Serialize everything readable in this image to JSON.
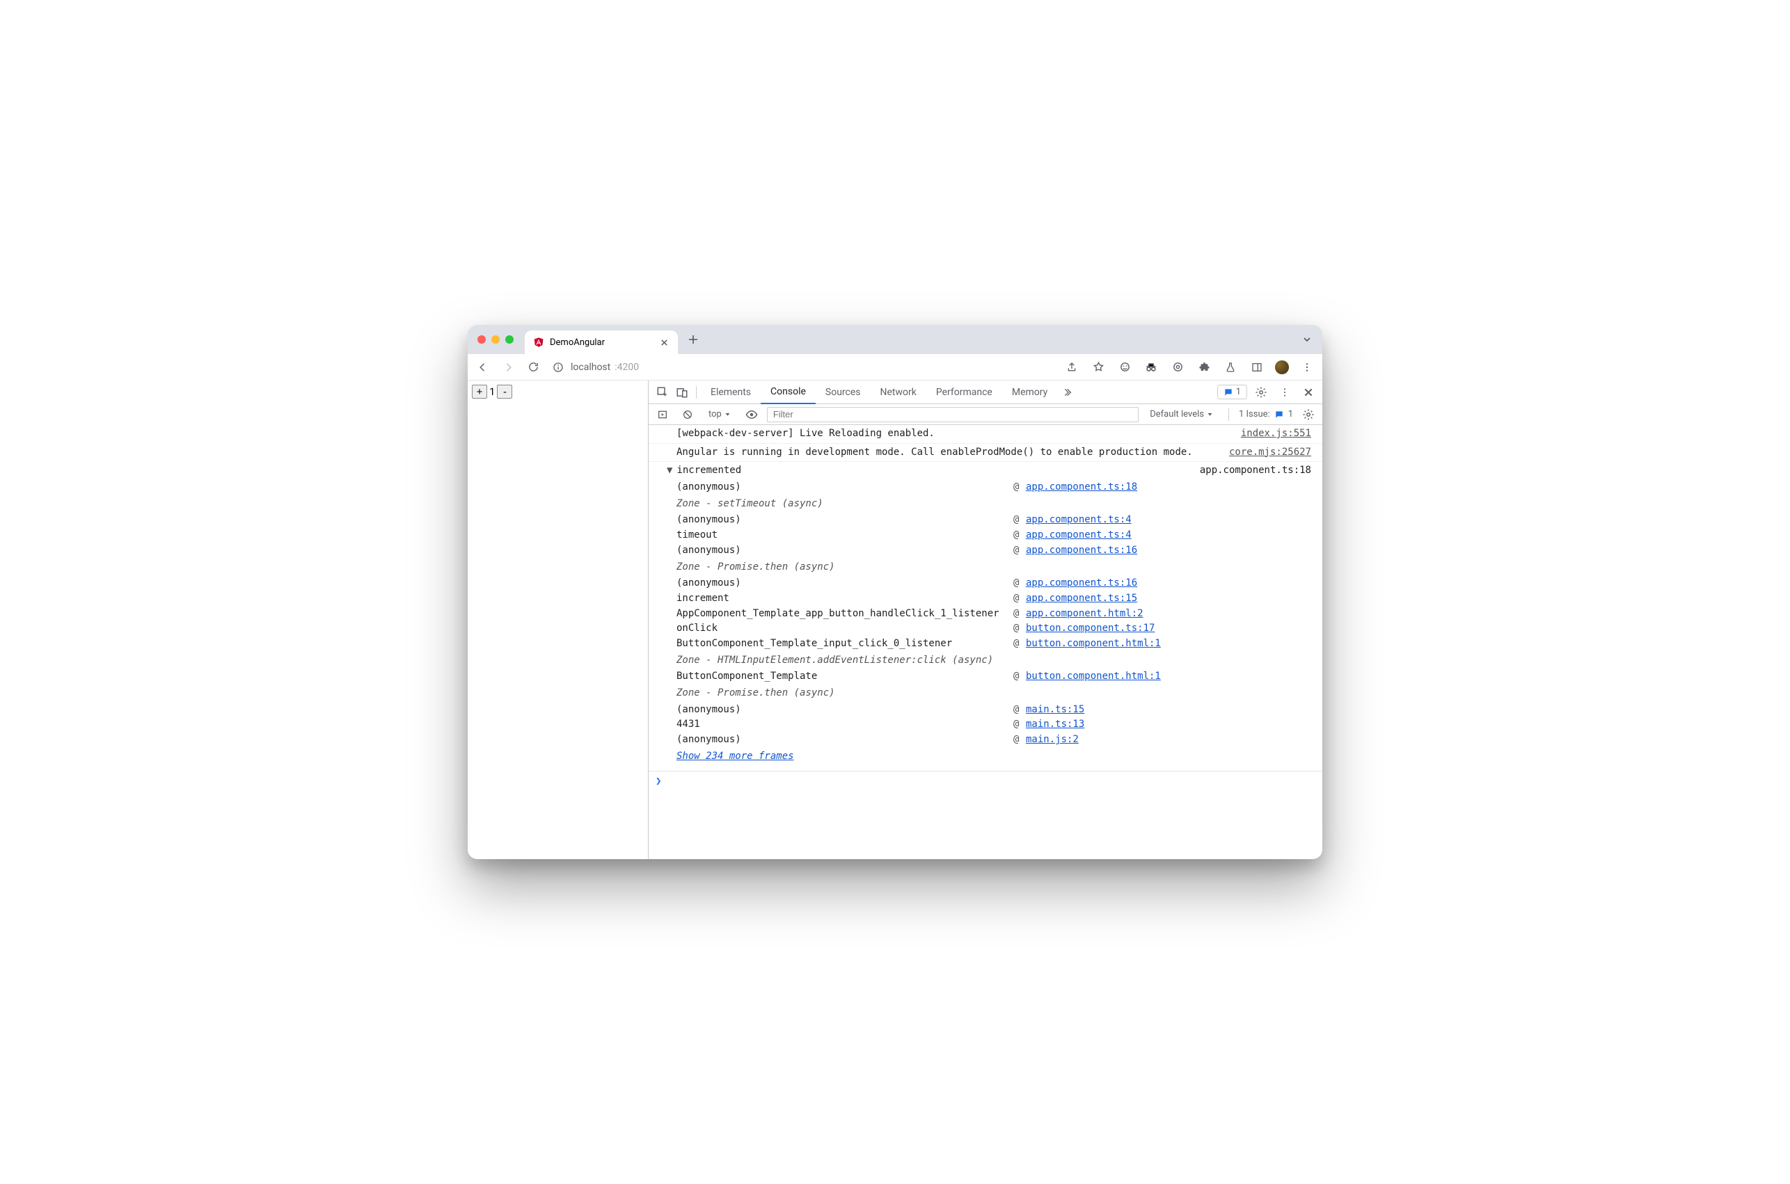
{
  "browserTab": {
    "title": "DemoAngular"
  },
  "address": {
    "host": "localhost",
    "port": ":4200"
  },
  "app": {
    "counterValue": "1",
    "plusLabel": "+",
    "minusLabel": "-"
  },
  "devtools": {
    "tabs": {
      "elements": "Elements",
      "console": "Console",
      "sources": "Sources",
      "network": "Network",
      "performance": "Performance",
      "memory": "Memory"
    },
    "msgBadge": "1",
    "toolbar": {
      "context": "top",
      "filterPlaceholder": "Filter",
      "levels": "Default levels",
      "issuesLabel": "1 Issue:",
      "issuesCount": "1"
    },
    "log1": {
      "text": "[webpack-dev-server] Live Reloading enabled.",
      "src": "index.js:551"
    },
    "log2": {
      "text": "Angular is running in development mode. Call enableProdMode() to enable production mode.",
      "src": "core.mjs:25627"
    },
    "trace": {
      "label": "incremented",
      "src": "app.component.ts:18",
      "frames": [
        {
          "fn": "(anonymous)",
          "link": "app.component.ts:18"
        },
        {
          "zone": "Zone - setTimeout (async)"
        },
        {
          "fn": "(anonymous)",
          "link": "app.component.ts:4"
        },
        {
          "fn": "timeout",
          "link": "app.component.ts:4"
        },
        {
          "fn": "(anonymous)",
          "link": "app.component.ts:16"
        },
        {
          "zone": "Zone - Promise.then (async)"
        },
        {
          "fn": "(anonymous)",
          "link": "app.component.ts:16"
        },
        {
          "fn": "increment",
          "link": "app.component.ts:15"
        },
        {
          "fn": "AppComponent_Template_app_button_handleClick_1_listener",
          "link": "app.component.html:2"
        },
        {
          "fn": "onClick",
          "link": "button.component.ts:17"
        },
        {
          "fn": "ButtonComponent_Template_input_click_0_listener",
          "link": "button.component.html:1"
        },
        {
          "zone": "Zone - HTMLInputElement.addEventListener:click (async)"
        },
        {
          "fn": "ButtonComponent_Template",
          "link": "button.component.html:1"
        },
        {
          "zone": "Zone - Promise.then (async)"
        },
        {
          "fn": "(anonymous)",
          "link": "main.ts:15"
        },
        {
          "fn": "4431",
          "link": "main.ts:13"
        },
        {
          "fn": "(anonymous)",
          "link": "main.js:2"
        }
      ],
      "more": "Show 234 more frames"
    }
  }
}
